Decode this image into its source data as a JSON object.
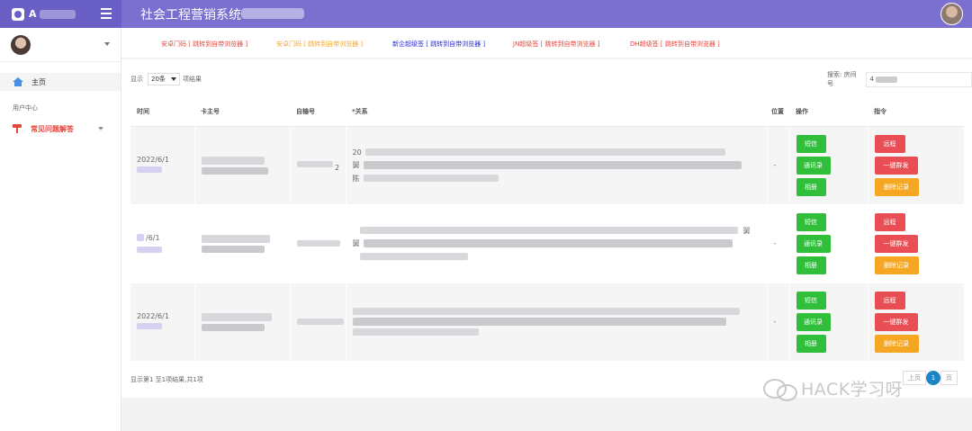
{
  "topbar": {
    "logo_letter": "A",
    "title": "社会工程营销系统",
    "accent": "#7b6fd0"
  },
  "sidebar": {
    "home_label": "主页",
    "section_label": "用户中心",
    "faq_label": "常见问题解答",
    "home_icon": "home-icon",
    "faq_icon": "paint-roller-icon"
  },
  "links": [
    {
      "text": "安卓门码 [ 跳转到自带浏览器 ]",
      "color": "#e6453b"
    },
    {
      "text": "安卓门码 [ 跳转到自带浏览器 ]",
      "color": "#f5a623"
    },
    {
      "text": "新企超级签 [ 跳转到自带浏览器 ]",
      "color": "#2b2bd6"
    },
    {
      "text": "JN超级签 [ 跳转到自带浏览器 ]",
      "color": "#e6453b"
    },
    {
      "text": "DH超级签 [ 跳转到自带浏览器 ]",
      "color": "#e6453b"
    }
  ],
  "controls": {
    "show_prefix": "显示",
    "page_size": "20条",
    "show_suffix": "项结果",
    "search_label": "搜索: 房间号",
    "search_value": "4"
  },
  "table": {
    "headers": [
      "时间",
      "卡主号",
      "自输号",
      "*关系",
      "位置",
      "操作",
      "指令"
    ],
    "rows": [
      {
        "time": "2022/6/1",
        "relation_prefix": "20",
        "relation_l2": "舅",
        "relation_l3": "陈",
        "position": "-",
        "self_suffix": "2"
      },
      {
        "time": "/6/1",
        "relation_prefix": "",
        "relation_l2": "舅",
        "relation_l3": "",
        "position": "-",
        "self_suffix": "",
        "relation_end": "舅"
      },
      {
        "time": "2022/6/1",
        "relation_prefix": "",
        "relation_l2": "",
        "relation_l3": "",
        "position": "-",
        "self_suffix": ""
      }
    ],
    "action_buttons": [
      "短信",
      "通讯录",
      "相册"
    ],
    "command_buttons": [
      "远程",
      "一键群发",
      "删除记录"
    ]
  },
  "footer": {
    "info": "显示第1 至1项结果,共1项",
    "pager_prev": "上页",
    "pager_current": "1",
    "pager_next": "页"
  },
  "watermark": {
    "text": "HACK学习呀",
    "icon": "wechat-icon"
  }
}
